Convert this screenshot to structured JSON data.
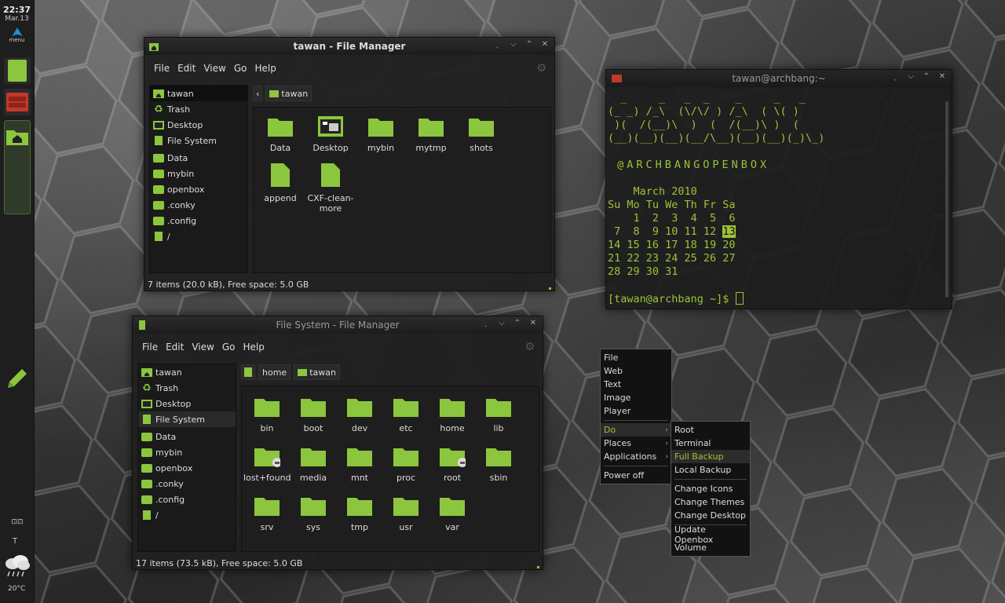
{
  "panel": {
    "time": "22:37",
    "date": "Mar.13",
    "menu_label": "menu",
    "temperature": "20°C",
    "tray_text": "⊡⊡",
    "t_glyph": "T"
  },
  "fm1": {
    "title": "tawan - File Manager",
    "menu": [
      "File",
      "Edit",
      "View",
      "Go",
      "Help"
    ],
    "sidebar": [
      "tawan",
      "Trash",
      "Desktop",
      "File System",
      "Data",
      "mybin",
      "openbox",
      ".conky",
      ".config",
      "/"
    ],
    "path": [
      "tawan"
    ],
    "files": [
      {
        "name": "Data",
        "icon": "folder-icon"
      },
      {
        "name": "Desktop",
        "icon": "desktop-folder-icon"
      },
      {
        "name": "mybin",
        "icon": "folder-icon"
      },
      {
        "name": "mytmp",
        "icon": "folder-icon"
      },
      {
        "name": "shots",
        "icon": "folder-icon"
      },
      {
        "name": "append",
        "icon": "file-icon"
      },
      {
        "name": "CXF-clean-more",
        "icon": "file-icon"
      }
    ],
    "status": "7 items (20.0 kB), Free space: 5.0 GB"
  },
  "fm2": {
    "title": "File System - File Manager",
    "menu": [
      "File",
      "Edit",
      "View",
      "Go",
      "Help"
    ],
    "sidebar": [
      "tawan",
      "Trash",
      "Desktop",
      "File System",
      "Data",
      "mybin",
      "openbox",
      ".conky",
      ".config",
      "/"
    ],
    "path": [
      "home",
      "tawan"
    ],
    "files": [
      "bin",
      "boot",
      "dev",
      "etc",
      "home",
      "lib",
      "lost+found",
      "media",
      "mnt",
      "proc",
      "root",
      "sbin",
      "srv",
      "sys",
      "tmp",
      "usr",
      "var"
    ],
    "status": "17 items (73.5 kB), Free space: 5.0 GB"
  },
  "terminal": {
    "title": "tawan@archbang:~",
    "ascii1": "  _     _   _  _    _     _   _",
    "ascii2": "(_ _) /_\\  (\\/\\/ ) /_\\  ( \\( )",
    "ascii3": " )(  /(__)\\  )  (  /(__)\\ )  (",
    "ascii4": "(__)(__)(__)(__/\\__)(__)(__)(_)\\_)",
    "banner": " @ARCHBANGOPENBOX",
    "cal_title": "    March 2010",
    "cal_head": "Su Mo Tu We Th Fr Sa",
    "cal_w1": "    1  2  3  4  5  6",
    "cal_w2a": " 7  8  9 10 11 12 ",
    "cal_today": "13",
    "cal_w3": "14 15 16 17 18 19 20",
    "cal_w4": "21 22 23 24 25 26 27",
    "cal_w5": "28 29 30 31",
    "prompt": "[tawan@archbang ~]$ "
  },
  "menu": {
    "items": [
      "File",
      "Web",
      "Text",
      "Image",
      "Player",
      "Do",
      "Places",
      "Applications",
      "Power off"
    ],
    "submenu": [
      "Root",
      "Terminal",
      "Full Backup",
      "Local Backup",
      "Change Icons",
      "Change Themes",
      "Change Desktop",
      "Update Openbox",
      "Volume"
    ]
  },
  "colors": {
    "accent": "#8cc63e",
    "terminal_text": "#9cc33a"
  }
}
